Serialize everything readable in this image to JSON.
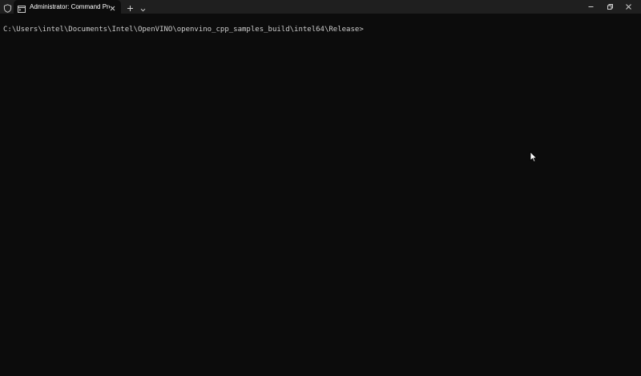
{
  "window": {
    "tab": {
      "title": "Administrator: Command Prompt"
    }
  },
  "terminal": {
    "prompt": "C:\\Users\\intel\\Documents\\Intel\\OpenVINO\\openvino_cpp_samples_build\\intel64\\Release>"
  },
  "colors": {
    "titlebar_bg": "#1f1f1f",
    "terminal_bg": "#0c0c0c",
    "terminal_text": "#cccccc",
    "tab_text": "#ffffff"
  },
  "icons": {
    "shield": "shield-icon",
    "terminal_tab": "terminal-icon",
    "close_tab": "close-icon",
    "new_tab": "plus-icon",
    "dropdown": "chevron-down-icon",
    "minimize": "minimize-icon",
    "restore": "restore-icon",
    "close_window": "close-icon",
    "mouse_pointer": "mouse-pointer-icon"
  }
}
